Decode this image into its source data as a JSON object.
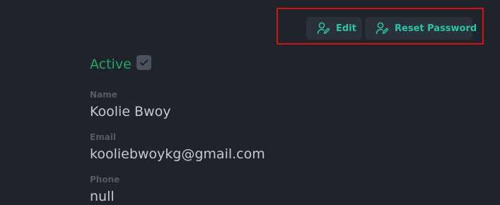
{
  "actions": {
    "edit_label": "Edit",
    "reset_password_label": "Reset Password",
    "icon": "user-edit-icon"
  },
  "status": {
    "label": "Active",
    "checked": true
  },
  "fields": {
    "name": {
      "label": "Name",
      "value": "Koolie Bwoy"
    },
    "email": {
      "label": "Email",
      "value": "kooliebwoykg@gmail.com"
    },
    "phone": {
      "label": "Phone",
      "value": "null"
    }
  },
  "colors": {
    "background": "#1f232a",
    "accent": "#2ec2a8",
    "active": "#21a56a",
    "highlight": "#d21414"
  }
}
